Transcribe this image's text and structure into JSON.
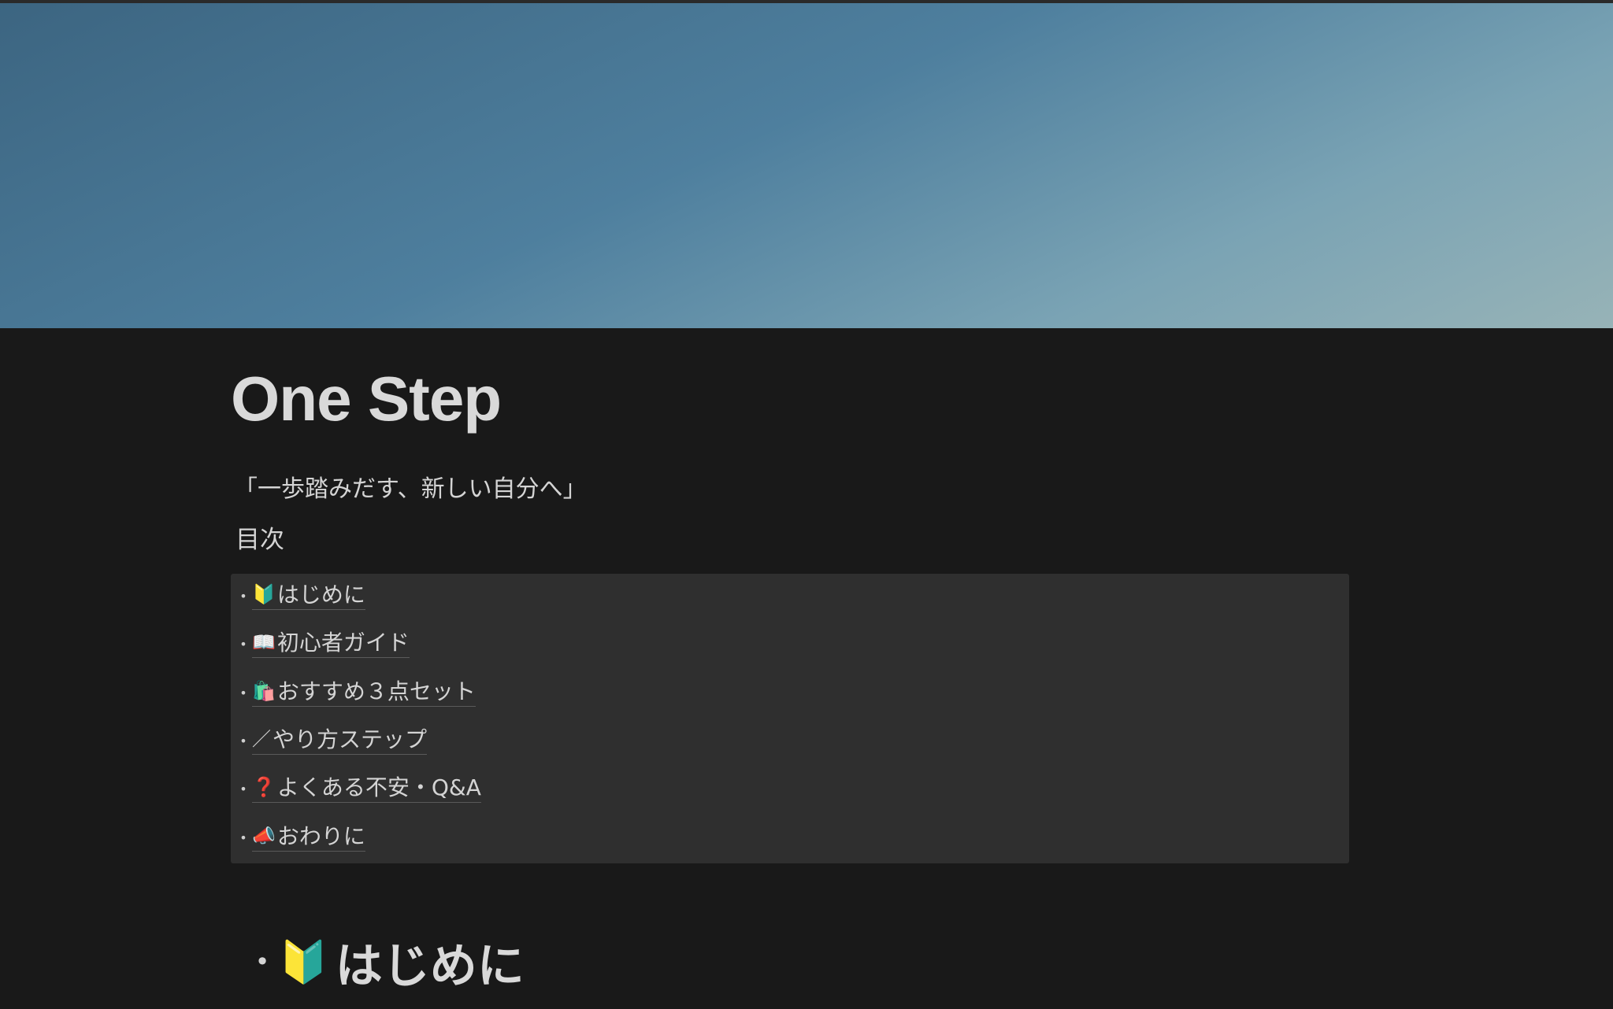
{
  "page": {
    "title": "One Step",
    "subtitle": "「一歩踏みだす、新しい自分へ」",
    "toc_heading": "目次"
  },
  "toc": {
    "items": [
      {
        "icon": "beginner-icon",
        "emoji": "🔰",
        "label": "はじめに"
      },
      {
        "icon": "book-icon",
        "emoji": "📖",
        "label": "初心者ガイド"
      },
      {
        "icon": "shopping-bags-icon",
        "emoji": "🛍️",
        "label": "おすすめ３点セット"
      },
      {
        "icon": "pencil-line-icon",
        "emoji": "／",
        "label": "やり方ステップ"
      },
      {
        "icon": "question-mark-icon",
        "emoji": "❓",
        "label": "よくある不安・Q&A"
      },
      {
        "icon": "megaphone-icon",
        "emoji": "📣",
        "label": "おわりに"
      }
    ]
  },
  "section": {
    "icon": "beginner-icon",
    "emoji": "🔰",
    "title": "はじめに"
  },
  "colors": {
    "background": "#191919",
    "toc_background": "#2f2f2f",
    "text": "#d4d4d4",
    "cover_start": "#3c6581",
    "cover_end": "#97b3b7"
  }
}
